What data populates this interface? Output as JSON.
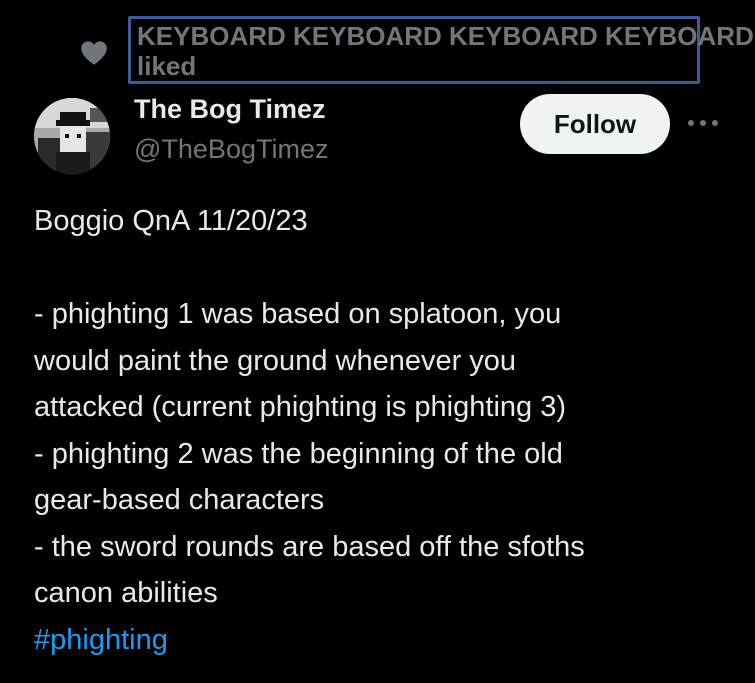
{
  "social_context": {
    "liked_by_line1": "KEYBOARD KEYBOARD KEYBOARD KEYBOARD",
    "liked_by_line2": "liked",
    "icon": "heart-icon"
  },
  "author": {
    "display_name": "The Bog Timez",
    "handle": "@TheBogTimez",
    "avatar_icon": "avatar"
  },
  "actions": {
    "follow_label": "Follow",
    "more_icon": "more-icon"
  },
  "tweet": {
    "lines": [
      "Boggio QnA 11/20/23",
      "",
      "- phighting 1 was based on splatoon, you",
      "would paint the ground whenever you",
      "attacked (current phighting is phighting 3)",
      "- phighting 2 was the beginning of the old",
      "gear-based characters",
      "- the sword rounds are based off the sfoths",
      "canon abilities"
    ],
    "hashtag": "#phighting"
  },
  "colors": {
    "background": "#000000",
    "text": "#e7e9ea",
    "muted": "#71767b",
    "link": "#1d9bf0",
    "follow_bg": "#eff3f4"
  }
}
